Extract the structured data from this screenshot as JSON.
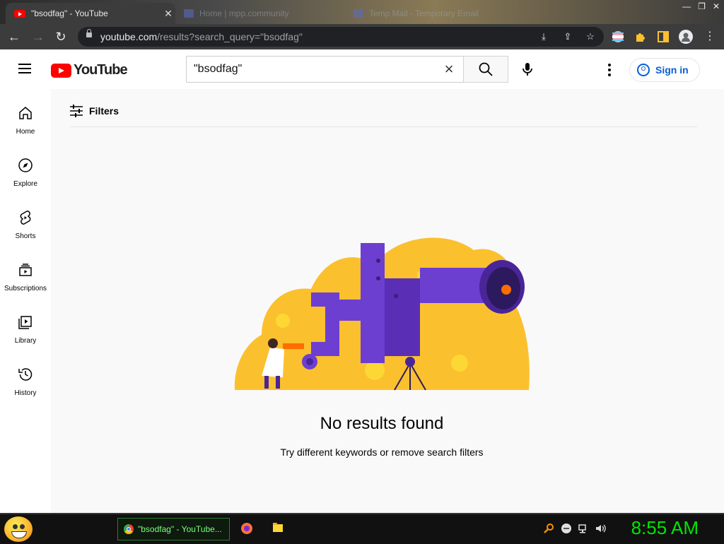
{
  "browser": {
    "tabs": [
      {
        "title": "\"bsodfag\" - YouTube",
        "close": "✕"
      },
      {
        "title": "Home | mpp.community"
      },
      {
        "title": "Temp Mail - Temporary Email"
      }
    ],
    "url_host": "youtube.com",
    "url_path": "/results?search_query=\"bsodfag\""
  },
  "masthead": {
    "logo_text": "YouTube",
    "search_value": "\"bsodfag\"",
    "signin_label": "Sign in"
  },
  "sidebar": {
    "items": [
      {
        "label": "Home",
        "icon": "home-icon"
      },
      {
        "label": "Explore",
        "icon": "compass-icon"
      },
      {
        "label": "Shorts",
        "icon": "shorts-icon"
      },
      {
        "label": "Subscriptions",
        "icon": "subscriptions-icon"
      },
      {
        "label": "Library",
        "icon": "library-icon"
      },
      {
        "label": "History",
        "icon": "history-icon"
      }
    ]
  },
  "main": {
    "filters_label": "Filters",
    "empty_title": "No results found",
    "empty_subtitle": "Try different keywords or remove search filters"
  },
  "taskbar": {
    "active_window": "\"bsodfag\" - YouTube...",
    "clock": "8:55 AM"
  },
  "colors": {
    "youtube_red": "#ff0000",
    "link_blue": "#065fd4",
    "illustration_yellow": "#fbc02d",
    "illustration_purple": "#6c3fd1",
    "clock_green": "#00e600"
  }
}
